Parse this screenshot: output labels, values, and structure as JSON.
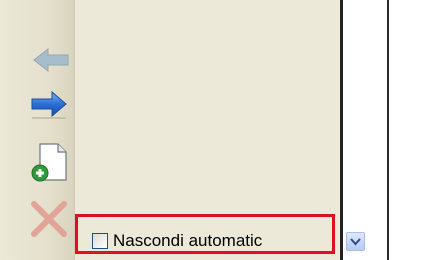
{
  "toolbar": {
    "buttons": [
      {
        "name": "back",
        "icon": "back-arrow-icon",
        "state": "disabled"
      },
      {
        "name": "forward",
        "icon": "forward-arrow-icon",
        "state": "enabled"
      },
      {
        "name": "new",
        "icon": "new-document-icon",
        "state": "enabled"
      },
      {
        "name": "delete",
        "icon": "delete-x-icon",
        "state": "disabled"
      }
    ]
  },
  "panel": {
    "autohide_label": "Nascondi automatic",
    "autohide_checked": false
  },
  "colors": {
    "highlight": "#e0101e",
    "arrow_active": "#2b6fd6",
    "arrow_disabled": "#9fb4c4",
    "delete_disabled": "#e3a69b"
  }
}
